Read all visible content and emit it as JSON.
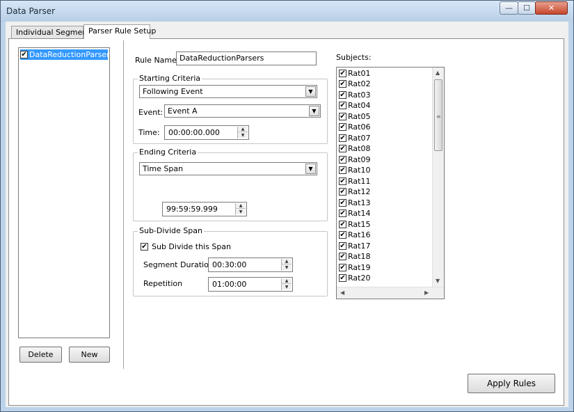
{
  "window": {
    "title": "Data Parser"
  },
  "title_buttons": {
    "minimize": "—",
    "maximize": "☐",
    "close": "✕"
  },
  "tabs": [
    {
      "label": "Individual Segments",
      "selected": false
    },
    {
      "label": "Parser Rule Setup",
      "selected": true
    }
  ],
  "rule_list": {
    "items": [
      {
        "label": "DataReductionParsers",
        "checked": true,
        "selected": true
      }
    ],
    "delete_label": "Delete",
    "new_label": "New"
  },
  "rule_name": {
    "label": "Rule Name:",
    "value": "DataReductionParsers"
  },
  "starting_criteria": {
    "title": "Starting Criteria",
    "mode": "Following Event",
    "event_label": "Event:",
    "event_value": "Event A",
    "time_label": "Time:",
    "time_value": "00:00:00.000"
  },
  "ending_criteria": {
    "title": "Ending Criteria",
    "mode": "Time Span",
    "span_value": "99:59:59.999"
  },
  "subdivide": {
    "title": "Sub-Divide Span",
    "checkbox_label": "Sub Divide this Span",
    "checked": true,
    "segment_label": "Segment Duration:",
    "segment_value": "00:30:00",
    "repetition_label": "Repetition",
    "repetition_value": "01:00:00"
  },
  "subjects": {
    "label": "Subjects:",
    "items": [
      "Rat01",
      "Rat02",
      "Rat03",
      "Rat04",
      "Rat05",
      "Rat06",
      "Rat07",
      "Rat08",
      "Rat09",
      "Rat10",
      "Rat11",
      "Rat12",
      "Rat13",
      "Rat14",
      "Rat15",
      "Rat16",
      "Rat17",
      "Rat18",
      "Rat19",
      "Rat20"
    ]
  },
  "apply_label": "Apply Rules",
  "icons": {
    "checkmark": "✔",
    "dropdown": "▼",
    "spin_up": "▲",
    "spin_down": "▼",
    "scroll_up": "▲",
    "scroll_down": "▼",
    "scroll_left": "◀",
    "scroll_right": "▶"
  },
  "colors": {
    "selection": "#3399ff",
    "window_frame": "#bcd3ea",
    "close_button": "#c6452a"
  }
}
